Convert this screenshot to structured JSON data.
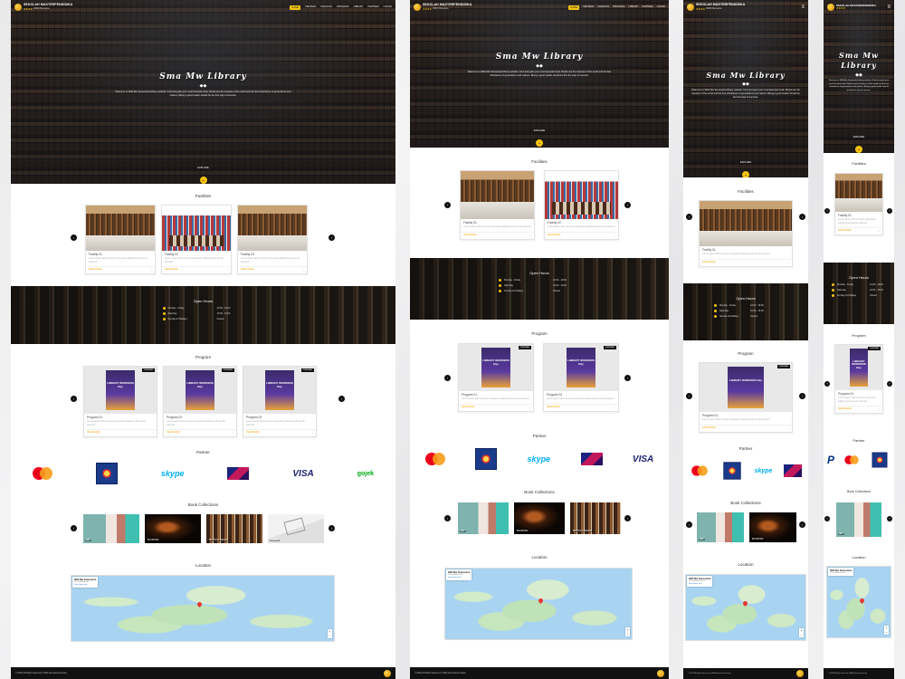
{
  "brand": {
    "name": "SEKOLAH MASTERPENDIDIKA",
    "stars": "★★★★",
    "tagline": "DIDIK Bersama",
    "logo_icon": "book-logo-icon"
  },
  "nav": {
    "items": [
      "HOME",
      "TENTANG",
      "FASILITAS",
      "PROGRAM",
      "LIBRARY",
      "PARTNER",
      "LOKASI"
    ],
    "active_index": 0,
    "menu_icon": "≡"
  },
  "hero": {
    "title": "Sma Mw Library",
    "divider": "◆◆",
    "description": "Welcome to SMA Mw Semesteria library website. Find and grab your most favourite book. Books are the treasure of the world and the fine inheritance of generations and nations. Being a good reader should be the first step of success.",
    "explore_label": "EXPLORE",
    "explore_icon": "⌄"
  },
  "facilities": {
    "title": "Facilities",
    "items": [
      {
        "name": "Facility 01",
        "desc": "Lorem ipsum dolor sit amet consectetur adipiscing elit sed do eiusmod",
        "more": "READ MORE"
      },
      {
        "name": "Facility 02",
        "desc": "Lorem ipsum dolor sit amet consectetur adipiscing elit sed do eiusmod",
        "more": "READ MORE"
      },
      {
        "name": "Facility 03",
        "desc": "Lorem ipsum dolor sit amet consectetur adipiscing elit sed do eiusmod",
        "more": "READ MORE"
      }
    ]
  },
  "open_hours": {
    "title": "Open Hours",
    "rows": [
      {
        "day": "Monday - Friday",
        "time": "13:00 - 19:00"
      },
      {
        "day": "Saturday",
        "time": "10:00 - 15:00"
      },
      {
        "day": "Sunday & Holidays",
        "time": "Closed"
      }
    ]
  },
  "program": {
    "title": "Program",
    "badge": "WEBINAR",
    "poster_text": "LIBRARY WORKERS Day",
    "items": [
      {
        "name": "Program 01",
        "desc": "Lorem ipsum dolor sit amet consectetur adipiscing elit sed do eiusmod",
        "more": "READ MORE"
      },
      {
        "name": "Program 02",
        "desc": "Lorem ipsum dolor sit amet consectetur adipiscing elit sed do eiusmod",
        "more": "READ MORE"
      },
      {
        "name": "Program 03",
        "desc": "Lorem ipsum dolor sit amet consectetur adipiscing elit sed do eiusmod",
        "more": "READ MORE"
      }
    ]
  },
  "partner": {
    "title": "Partner",
    "skype": "skype",
    "visa": "VISA",
    "gojek": "gojek",
    "paypal": "P"
  },
  "collections": {
    "title": "Book Collections",
    "items": [
      "ART",
      "BUDDHISM",
      "BUTTON & DESIGN",
      "DESIGN"
    ]
  },
  "location": {
    "title": "Location",
    "place": "SMA Mw Semesteria",
    "address": "Jl. Pendidikan No. 1",
    "link": "View larger map",
    "zoom": "+ −"
  },
  "footer": {
    "copyright": "© 2022 All Rights Reserved | SMA Semesteria Library"
  },
  "colors": {
    "accent": "#f4c20d",
    "dark": "#111111"
  }
}
